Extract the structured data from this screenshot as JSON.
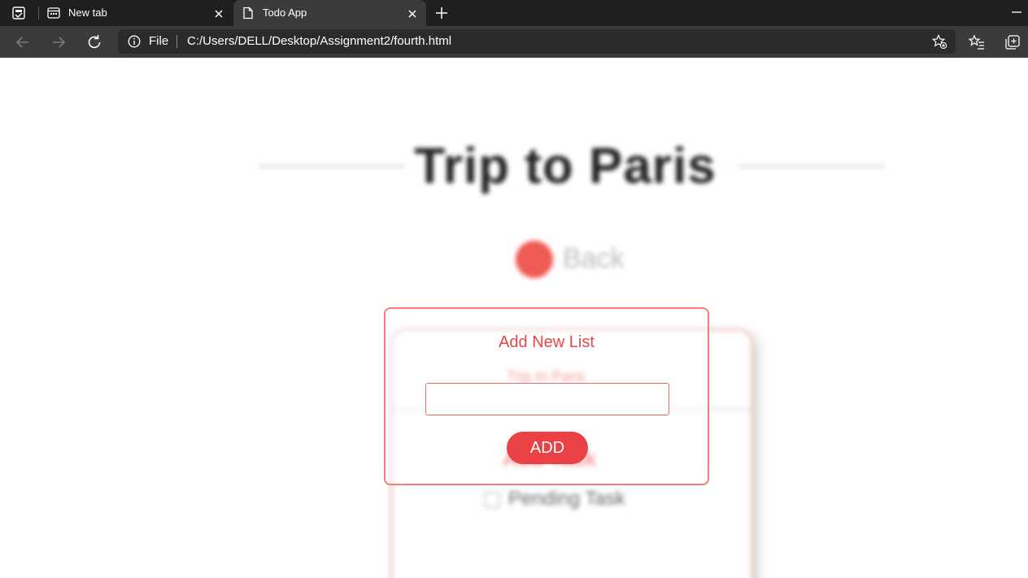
{
  "browser": {
    "tabs": [
      {
        "title": "New tab",
        "active": false,
        "icon": "new-tab-page-icon"
      },
      {
        "title": "Todo App",
        "active": true,
        "icon": "page-document-icon"
      }
    ],
    "address": {
      "site_label": "File",
      "url": "C:/Users/DELL/Desktop/Assignment2/fourth.html"
    },
    "icons": [
      "tab-actions-icon",
      "close-icon",
      "plus-icon",
      "minimize-icon",
      "back-arrow-icon",
      "forward-arrow-icon",
      "reload-icon",
      "info-icon",
      "favorite-add-icon",
      "favorites-icon",
      "collections-icon"
    ]
  },
  "page": {
    "heading": "Trip to Paris",
    "back_label": "Back",
    "card": {
      "title": "Trip to Paris",
      "add_task_label": "Add Task",
      "pending_task_label": "Pending Task"
    }
  },
  "modal": {
    "title": "Add New List",
    "input_value": "",
    "input_placeholder": "",
    "add_button_label": "ADD"
  },
  "colors": {
    "accent": "#ea4144",
    "accent_light": "#f05a54",
    "chrome_dark": "#1f1f1f",
    "chrome_toolbar": "#3b3b3b"
  }
}
